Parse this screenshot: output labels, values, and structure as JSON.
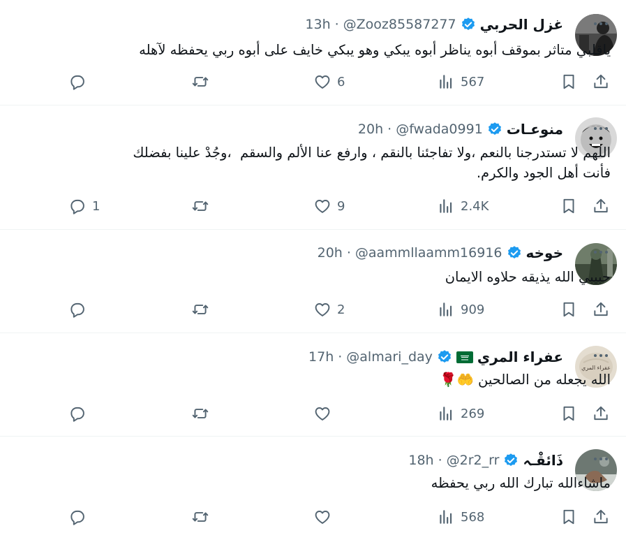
{
  "tweets": [
    {
      "name": "غزل الحربي",
      "handle": "@Zooz85587277",
      "sep": "·",
      "time": "13h",
      "text": "ياقلبي متاثر بموقف أبوه يناظر أبوه يبكي وهو يبكي خايف على أبوه ربي يحفظه لآهله",
      "replies": "",
      "reposts": "",
      "likes": "6",
      "views": "567",
      "avatar_color": "#3b3b3b",
      "flag": false
    },
    {
      "name": "منوعـات",
      "handle": "@fwada0991",
      "sep": "·",
      "time": "20h",
      "text": "اللهم لا تستدرجنا بالنعم ،ولا تفاجئنا بالنقم ، وارفع عنا الألم والسقم  ،وجُدْ علينا بفضلك\nفأنت أهل الجود والكرم.",
      "replies": "1",
      "reposts": "",
      "likes": "9",
      "views": "2.4K",
      "avatar_color": "#2a2a2a",
      "flag": false
    },
    {
      "name": "خوخه",
      "handle": "@aammllaamm16916",
      "sep": "·",
      "time": "20h",
      "text": "حبيبي الله يذيقه حلاوه الايمان",
      "replies": "",
      "reposts": "",
      "likes": "2",
      "views": "909",
      "avatar_color": "#4a5a46",
      "flag": false
    },
    {
      "name": "عفراء المري",
      "handle": "@almari_day",
      "sep": "·",
      "time": "17h",
      "text": "الله يجعله من الصالحين 🤲🌹",
      "replies": "",
      "reposts": "",
      "likes": "",
      "views": "269",
      "avatar_color": "#e9e2d6",
      "avatar_caption": "عفراء المري",
      "flag": true
    },
    {
      "name": "ذَائقْـہ",
      "handle": "@2r2_rr",
      "sep": "·",
      "time": "18h",
      "text": "ماشاءالله تبارك الله ربي يحفظه",
      "replies": "",
      "reposts": "",
      "likes": "",
      "views": "568",
      "avatar_color": "#5b6660",
      "flag": false
    }
  ],
  "colors": {
    "verified": "#1d9bf0",
    "muted": "#536471",
    "divider": "#eff3f4",
    "flag_green": "#006c35"
  },
  "icons": [
    "more-icon",
    "reply-icon",
    "repost-icon",
    "like-icon",
    "views-icon",
    "bookmark-icon",
    "share-icon",
    "verified-badge-icon",
    "saudi-flag-icon"
  ]
}
